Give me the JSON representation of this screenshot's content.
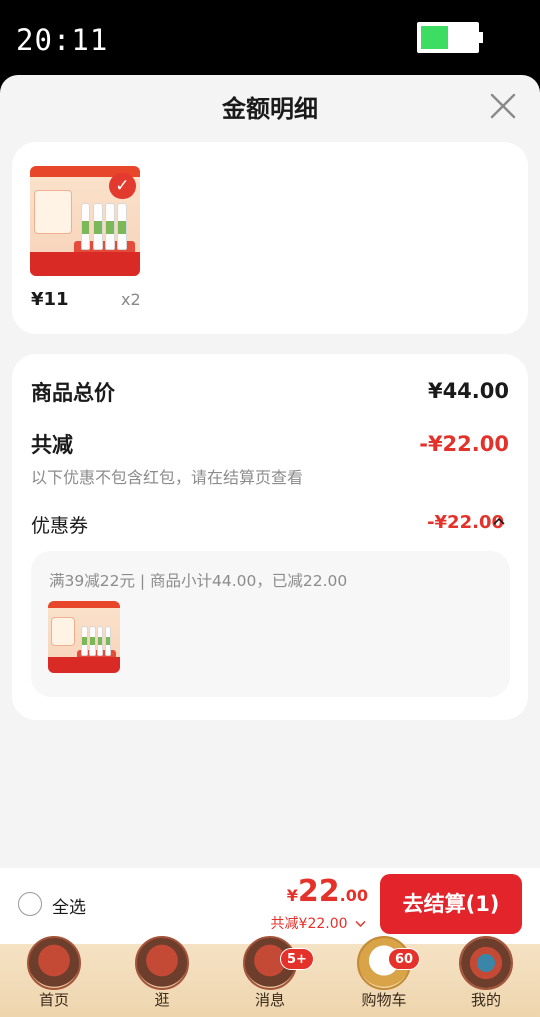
{
  "status_bar": {
    "time": "20:11",
    "battery_fraction": 0.5
  },
  "sheet": {
    "title": "金额明细"
  },
  "item": {
    "price": "¥11",
    "qty": "x2"
  },
  "summary": {
    "total_label": "商品总价",
    "total_value": "¥44.00",
    "reduce_label": "共减",
    "reduce_value": "-¥22.00",
    "reduce_note": "以下优惠不包含红包，请在结算页查看",
    "coupon_label": "优惠券",
    "coupon_value": "-¥22.00",
    "coupon_desc": "满39减22元 | 商品小计44.00，已减22.00"
  },
  "actionbar": {
    "select_all": "全选",
    "currency": "¥",
    "price_int": "22",
    "price_dec": ".00",
    "sub_text": "共减¥22.00",
    "checkout": "去结算(1)"
  },
  "tabs": [
    {
      "label": "首页",
      "icon": "home-icon",
      "badge": ""
    },
    {
      "label": "逛",
      "icon": "browse-icon",
      "badge": ""
    },
    {
      "label": "消息",
      "icon": "message-icon",
      "badge": "5+"
    },
    {
      "label": "购物车",
      "icon": "cart-icon",
      "badge": "60"
    },
    {
      "label": "我的",
      "icon": "profile-icon",
      "badge": ""
    }
  ],
  "colors": {
    "accent": "#e4322b",
    "checkout": "#e4242b",
    "battery": "#3ddc63"
  }
}
